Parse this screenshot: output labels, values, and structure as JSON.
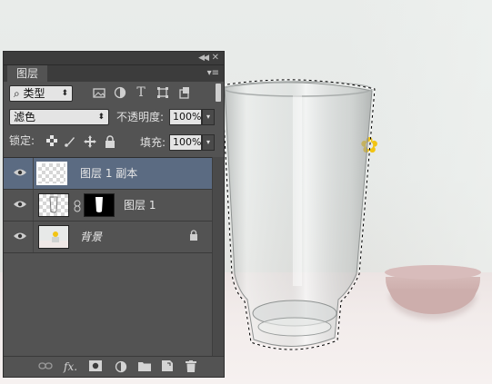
{
  "panel": {
    "tab_label": "图层",
    "collapse_glyph": "◀◀",
    "close_glyph": "✕",
    "menu_glyph": "▾≡"
  },
  "filter": {
    "kind_label": "⌕ 类型",
    "kind_arrow": "⬍",
    "icons": [
      "image-filter-icon",
      "adjustment-filter-icon",
      "type-filter-icon",
      "shape-filter-icon",
      "smart-object-filter-icon"
    ]
  },
  "blend": {
    "mode_value": "滤色",
    "mode_arrow": "⬍",
    "opacity_label": "不透明度:",
    "opacity_value": "100%",
    "opacity_arrow": "▾"
  },
  "locks": {
    "lock_label": "锁定:",
    "fill_label": "填充:",
    "fill_value": "100%",
    "fill_arrow": "▾"
  },
  "layers": [
    {
      "name": "图层 1 副本",
      "selected": true,
      "has_mask": false,
      "locked": false
    },
    {
      "name": "图层 1",
      "selected": false,
      "has_mask": true,
      "locked": false
    },
    {
      "name": "背景",
      "selected": false,
      "has_mask": false,
      "locked": true
    }
  ],
  "bottom_icons": [
    "link-layers-icon",
    "fx-icon",
    "add-mask-icon",
    "adjustment-layer-icon",
    "new-group-icon",
    "new-layer-icon",
    "delete-layer-icon"
  ],
  "glyphs": {
    "fx": "fx.",
    "link": "⊖",
    "chain": "🔗",
    "lock": "🔒"
  },
  "colors": {
    "panel_bg": "#535353",
    "selected_row": "#5b6b82",
    "flower": "#f2c413",
    "bowl": "#cdaeac"
  }
}
